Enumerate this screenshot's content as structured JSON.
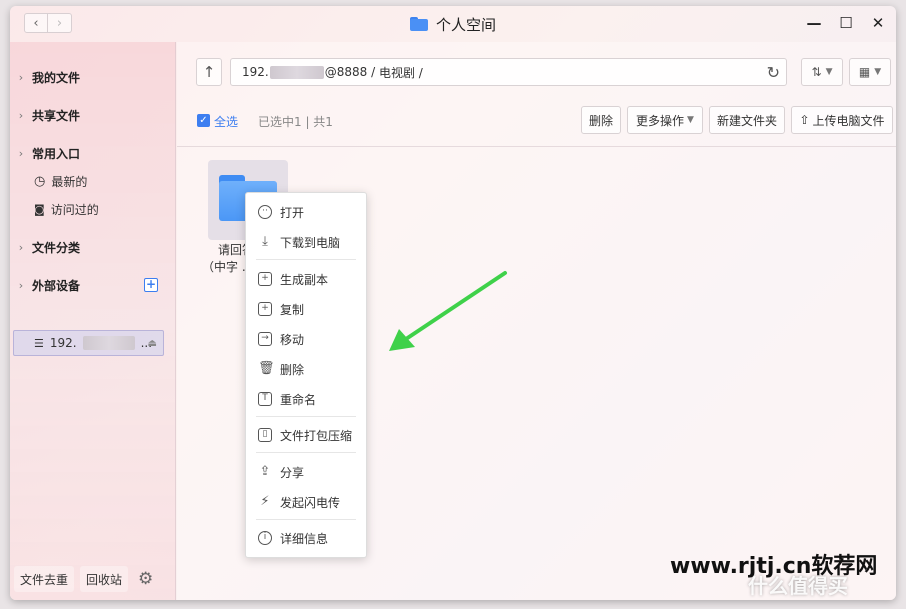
{
  "window": {
    "title": "个人空间",
    "controls": [
      "minimize",
      "maximize",
      "close"
    ]
  },
  "sidebar": {
    "sections": [
      {
        "label": "我的文件"
      },
      {
        "label": "共享文件"
      },
      {
        "label": "常用入口",
        "children": [
          {
            "label": "最新的",
            "icon": "clock-icon"
          },
          {
            "label": "访问过的",
            "icon": "camera-icon"
          }
        ]
      },
      {
        "label": "文件分类"
      },
      {
        "label": "外部设备",
        "action": "+"
      }
    ],
    "device": {
      "prefix": "192.",
      "suffix": "..."
    },
    "bottom": {
      "dedupe": "文件去重",
      "recycle": "回收站"
    }
  },
  "toolbar": {
    "address": {
      "prefix": "192.",
      "middle": "@8888 / ",
      "path": "电视剧 /"
    },
    "select_all": "全选",
    "selection_info": "已选中1 | 共1",
    "buttons": {
      "delete": "删除",
      "more": "更多操作",
      "new_folder": "新建文件夹",
      "upload": "上传电脑文件"
    }
  },
  "files": [
    {
      "name_line1": "请回答",
      "name_line2": "（中字 ..."
    }
  ],
  "context_menu": {
    "items": [
      {
        "label": "打开",
        "icon": "open-icon"
      },
      {
        "label": "下载到电脑",
        "icon": "download-icon"
      },
      {
        "label": "生成副本",
        "icon": "copy-plus-icon"
      },
      {
        "label": "复制",
        "icon": "duplicate-icon"
      },
      {
        "label": "移动",
        "icon": "move-icon"
      },
      {
        "label": "删除",
        "icon": "trash-icon"
      },
      {
        "label": "重命名",
        "icon": "text-icon"
      },
      {
        "label": "文件打包压缩",
        "icon": "zip-icon"
      },
      {
        "label": "分享",
        "icon": "share-icon"
      },
      {
        "label": "发起闪电传",
        "icon": "lightning-icon"
      },
      {
        "label": "详细信息",
        "icon": "info-icon"
      }
    ]
  },
  "colors": {
    "accent": "#3d7ef0",
    "arrow": "#3fd14a",
    "folder": "#4b97f6"
  },
  "watermark": {
    "main": "www.rjtj.cn软荐网",
    "secondary": "什么值得买"
  }
}
